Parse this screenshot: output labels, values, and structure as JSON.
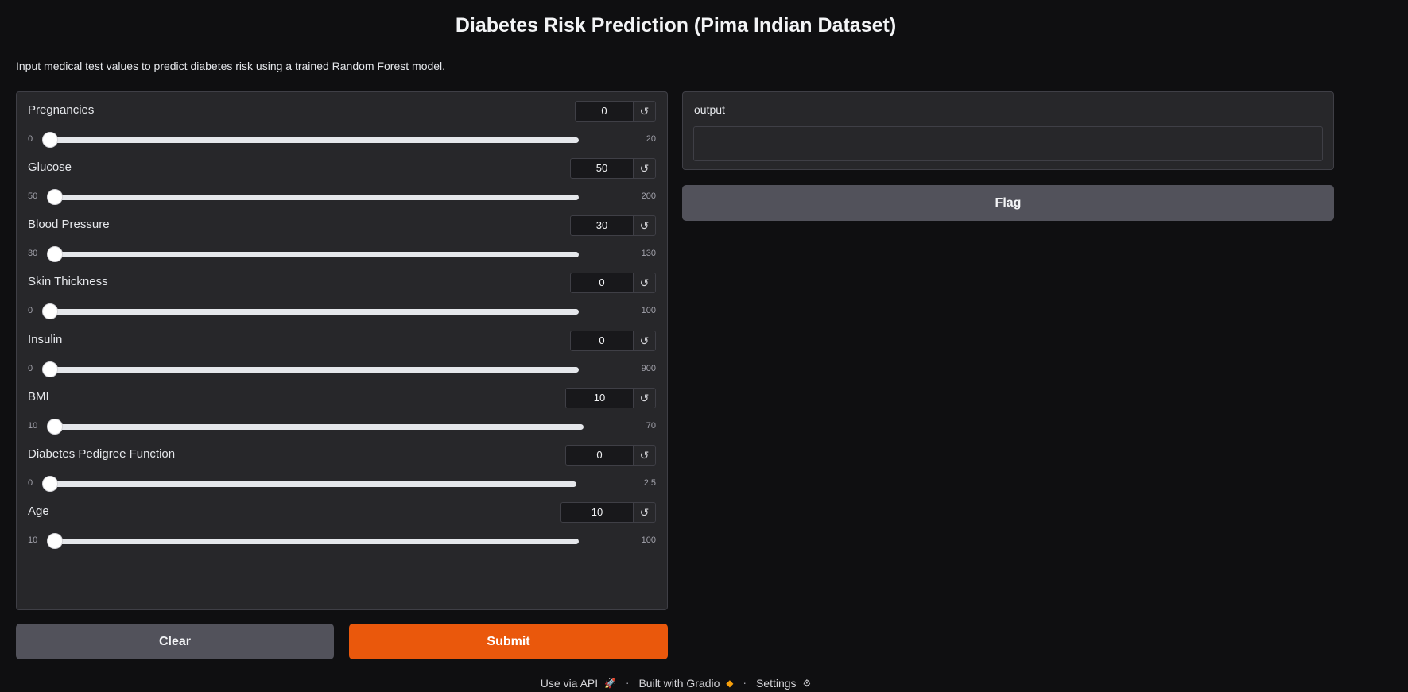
{
  "header": {
    "title": "Diabetes Risk Prediction (Pima Indian Dataset)",
    "description": "Input medical test values to predict diabetes risk using a trained Random Forest model."
  },
  "inputs": [
    {
      "label": "Pregnancies",
      "value": "0",
      "min": "0",
      "max": "20"
    },
    {
      "label": "Glucose",
      "value": "50",
      "min": "50",
      "max": "200"
    },
    {
      "label": "Blood Pressure",
      "value": "30",
      "min": "30",
      "max": "130"
    },
    {
      "label": "Skin Thickness",
      "value": "0",
      "min": "0",
      "max": "100"
    },
    {
      "label": "Insulin",
      "value": "0",
      "min": "0",
      "max": "900"
    },
    {
      "label": "BMI",
      "value": "10",
      "min": "10",
      "max": "70"
    },
    {
      "label": "Diabetes Pedigree Function",
      "value": "0",
      "min": "0",
      "max": "2.5"
    },
    {
      "label": "Age",
      "value": "10",
      "min": "10",
      "max": "100"
    }
  ],
  "reset_icon": "reset-icon",
  "output": {
    "label": "output",
    "value": ""
  },
  "buttons": {
    "flag": "Flag",
    "clear": "Clear",
    "submit": "Submit"
  },
  "footer": {
    "api": "Use via API",
    "built": "Built with Gradio",
    "settings": "Settings"
  },
  "colors": {
    "primary": "#ea580c",
    "secondary": "#52525b",
    "panel": "#27272a",
    "background": "#0f0f11"
  }
}
